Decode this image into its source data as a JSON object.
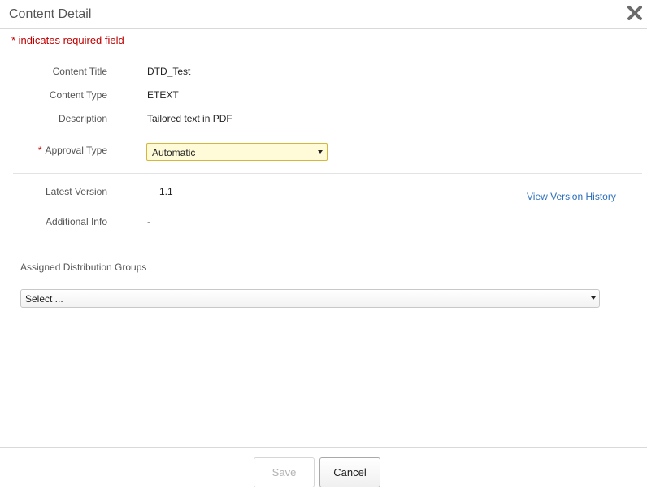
{
  "dialog": {
    "title": "Content Detail",
    "close_icon": "close-icon",
    "required_note": "* indicates required field"
  },
  "fields": {
    "content_title": {
      "label": "Content Title",
      "value": "DTD_Test"
    },
    "content_type": {
      "label": "Content Type",
      "value": "ETEXT"
    },
    "description": {
      "label": "Description",
      "value": "Tailored text in PDF"
    },
    "approval_type": {
      "required_mark": "*",
      "label": "Approval Type",
      "selected": "Automatic"
    }
  },
  "version": {
    "latest_label": "Latest Version",
    "latest_value": "1.1",
    "history_link": "View Version History",
    "additional_label": "Additional Info",
    "additional_value": "-"
  },
  "distribution": {
    "label": "Assigned Distribution Groups",
    "selected": "Select ..."
  },
  "footer": {
    "save_label": "Save",
    "cancel_label": "Cancel"
  },
  "colors": {
    "required": "#c00000",
    "link": "#2a6ebb",
    "select_highlight_bg": "#fffbd9",
    "select_highlight_border": "#d4b83a"
  }
}
